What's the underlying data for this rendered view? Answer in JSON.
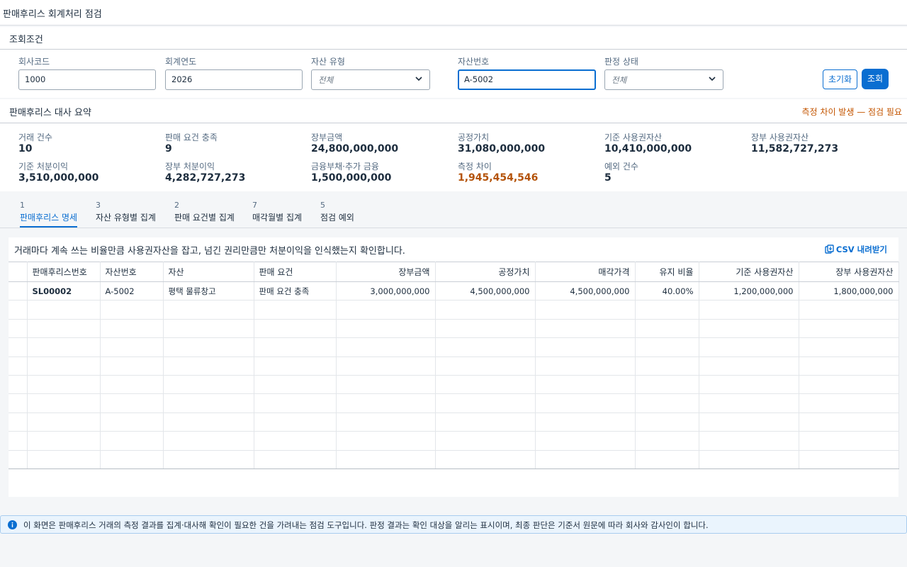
{
  "page": {
    "title": "판매후리스 회계처리 점검"
  },
  "filters": {
    "title": "조회조건",
    "company_code": {
      "label": "회사코드",
      "value": "1000"
    },
    "fiscal_year": {
      "label": "회계연도",
      "value": "2026"
    },
    "asset_type": {
      "label": "자산 유형",
      "value": "전체"
    },
    "asset_no": {
      "label": "자산번호",
      "value": "A-5002"
    },
    "status": {
      "label": "판정 상태",
      "value": "전체"
    },
    "reset_label": "초기화",
    "search_label": "조회"
  },
  "summary": {
    "title": "판매후리스 대사 요약",
    "alert": "측정 차이 발생 — 점검 필요",
    "items": [
      {
        "label": "거래 건수",
        "value": "10"
      },
      {
        "label": "판매 요건 충족",
        "value": "9"
      },
      {
        "label": "장부금액",
        "value": "24,800,000,000"
      },
      {
        "label": "공정가치",
        "value": "31,080,000,000"
      },
      {
        "label": "기준 사용권자산",
        "value": "10,410,000,000"
      },
      {
        "label": "장부 사용권자산",
        "value": "11,582,727,273"
      },
      {
        "label": "기준 처분이익",
        "value": "3,510,000,000"
      },
      {
        "label": "장부 처분이익",
        "value": "4,282,727,273"
      },
      {
        "label": "금융부채·추가 금융",
        "value": "1,500,000,000"
      },
      {
        "label": "측정 차이",
        "value": "1,945,454,546"
      },
      {
        "label": "예외 건수",
        "value": "5"
      }
    ]
  },
  "tabs": [
    {
      "count": "1",
      "label": "판매후리스 명세"
    },
    {
      "count": "3",
      "label": "자산 유형별 집계"
    },
    {
      "count": "2",
      "label": "판매 요건별 집계"
    },
    {
      "count": "7",
      "label": "매각월별 집계"
    },
    {
      "count": "5",
      "label": "점검 예외"
    }
  ],
  "table": {
    "description": "거래마다 계속 쓰는 비율만큼 사용권자산을 잡고, 넘긴 권리만큼만 처분이익을 인식했는지 확인합니다.",
    "csv_label": "CSV 내려받기",
    "columns": [
      "",
      "판매후리스번호",
      "자산번호",
      "자산",
      "판매 요건",
      "장부금액",
      "공정가치",
      "매각가격",
      "유지 비율",
      "기준 사용권자산",
      "장부 사용권자산"
    ],
    "rows": [
      [
        "",
        "SL00002",
        "A-5002",
        "평택 물류창고",
        "판매 요건 충족",
        "3,000,000,000",
        "4,500,000,000",
        "4,500,000,000",
        "40.00%",
        "1,200,000,000",
        "1,800,000,000"
      ]
    ]
  },
  "info": {
    "text": "이 화면은 판매후리스 거래의 측정 결과를 집계·대사해 확인이 필요한 건을 가려내는 점검 도구입니다. 판정 결과는 확인 대상을 알리는 표시이며, 최종 판단은 기준서 원문에 따라 회사와 감사인이 합니다."
  },
  "colors": {
    "accent": "#0a6ed1",
    "warning": "#b45309",
    "info_bg": "#eaf4fd"
  }
}
